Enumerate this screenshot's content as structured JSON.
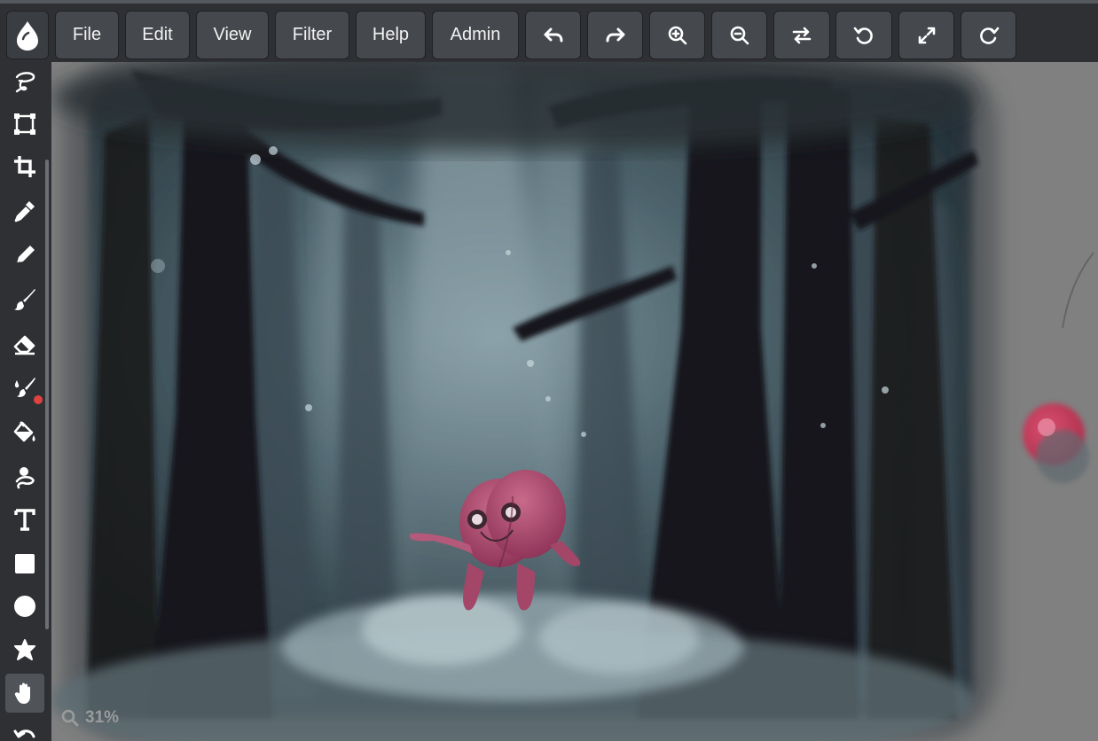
{
  "menu": {
    "file": "File",
    "edit": "Edit",
    "view": "View",
    "filter": "Filter",
    "help": "Help",
    "admin": "Admin"
  },
  "toolbar_icons": [
    "undo-icon",
    "redo-icon",
    "zoom-in-icon",
    "zoom-out-icon",
    "swap-icon",
    "rotate-left-icon",
    "fullscreen-icon",
    "rotate-right-icon"
  ],
  "tools": [
    "lasso-icon",
    "transform-icon",
    "crop-icon",
    "eyedropper-icon",
    "pencil-icon",
    "brush-icon",
    "eraser-icon",
    "blend-brush-icon",
    "fill-bucket-icon",
    "smudge-icon",
    "text-icon",
    "rectangle-icon",
    "ellipse-icon",
    "shape-icon",
    "hand-icon",
    "undo-curve-icon"
  ],
  "active_tool": "hand-icon",
  "zoom": {
    "label": "31%"
  },
  "colors": {
    "toolbar_bg": "#2e3033",
    "button_bg": "#45484d",
    "canvas_bg": "#808080",
    "accent_red": "#e0433f",
    "brush_cursor": "#d63a5b"
  }
}
